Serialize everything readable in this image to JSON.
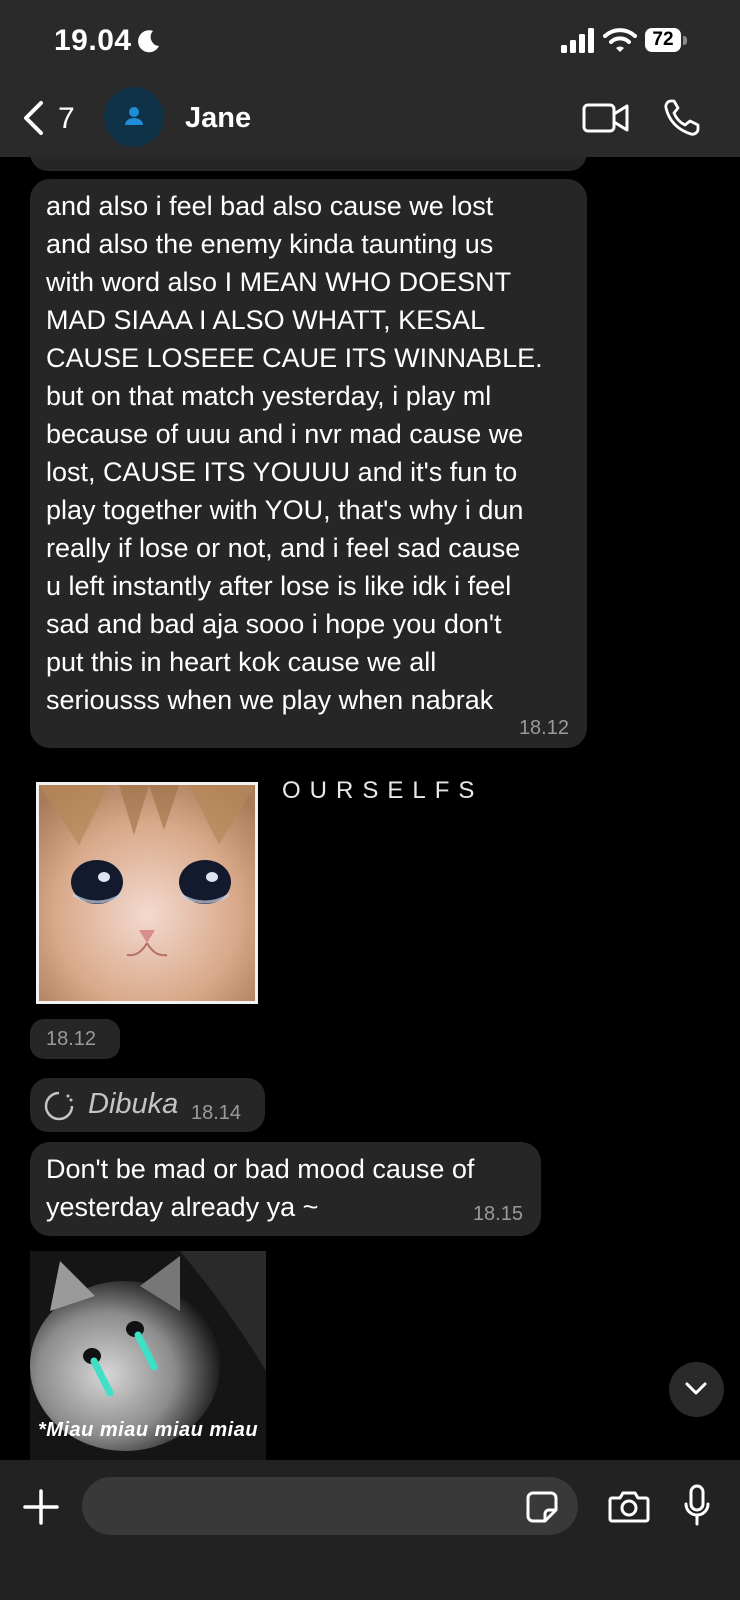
{
  "status_bar": {
    "time": "19.04",
    "battery": "72"
  },
  "header": {
    "back_count": "7",
    "contact_name": "Jane"
  },
  "messages": [
    {
      "type": "text",
      "text": "and also i feel bad also cause we lost\nand also the enemy kinda taunting us\nwith word also I MEAN WHO DOESNT\nMAD SIAAA I ALSO WHATT, KESAL\nCAUSE LOSEEE CAUE ITS WINNABLE.\nbut on that match yesterday, i play ml\nbecause of uuu and i nvr mad cause we\nlost, CAUSE ITS YOUUU and it's fun to\nplay together with YOU, that's why i dun\nreally if lose or not, and i feel sad cause\nu left instantly after lose is like idk i feel\nsad and bad aja sooo i hope you don't\nput this in heart kok cause we all\nseriousss when we play when nabrak",
      "time": "18.12"
    },
    {
      "type": "sticker",
      "caption": "OURSELFS",
      "time": "18.12"
    },
    {
      "type": "view_once",
      "label": "Dibuka",
      "time": "18.14"
    },
    {
      "type": "text",
      "text": "Don't be mad or bad mood cause of yesterday already ya ~",
      "time": "18.15"
    },
    {
      "type": "image",
      "caption": "*Miau miau miau miau"
    }
  ],
  "input": {
    "placeholder": ""
  },
  "icons": {
    "back": "chevron-left-icon",
    "video": "video-call-icon",
    "call": "phone-icon",
    "plus": "plus-icon",
    "sticker": "sticker-icon",
    "camera": "camera-icon",
    "mic": "microphone-icon",
    "scroll": "chevron-down-icon"
  },
  "colors": {
    "background": "#000000",
    "bubble": "#262626",
    "header": "#2a2a2a",
    "accent_avatar": "#1e8fd6",
    "tear": "#3fe0c8"
  }
}
